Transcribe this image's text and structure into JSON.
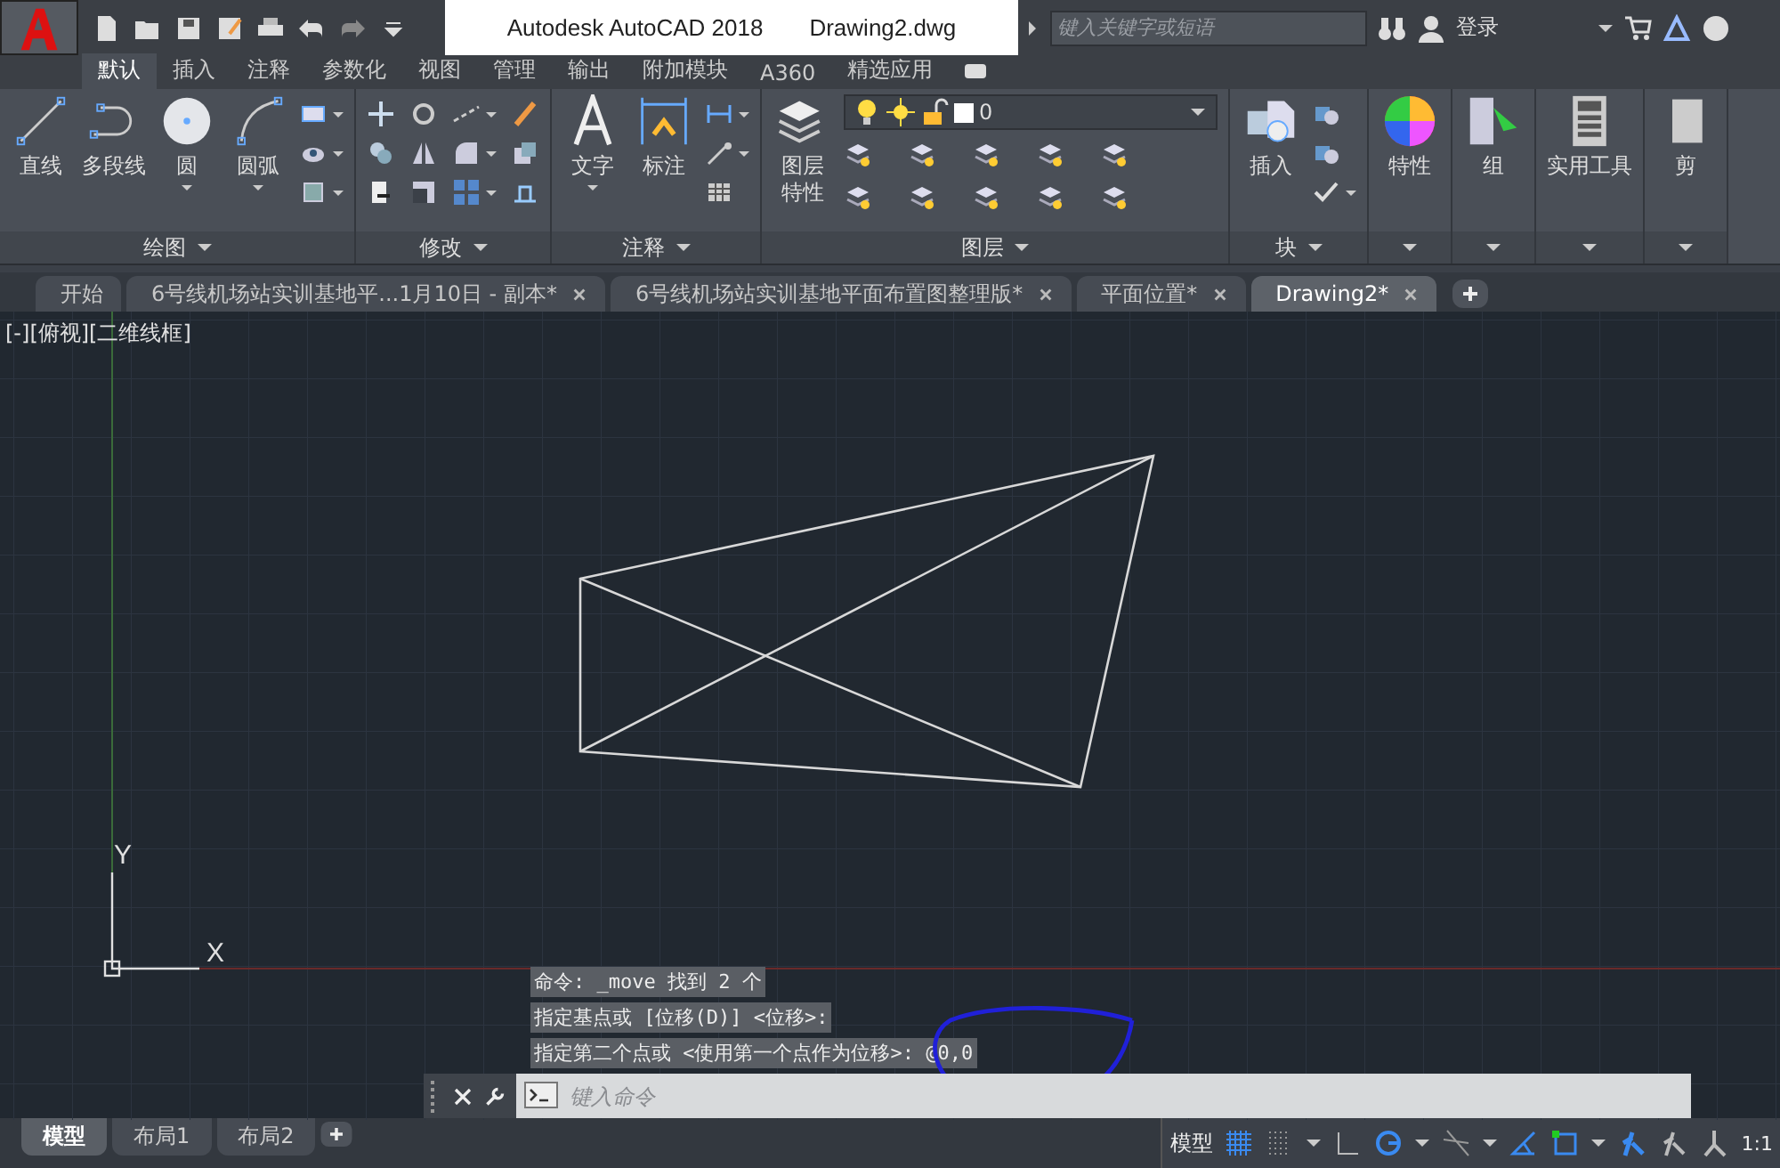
{
  "title": {
    "app": "Autodesk AutoCAD 2018",
    "document": "Drawing2.dwg"
  },
  "search": {
    "placeholder": "键入关键字或短语"
  },
  "user": {
    "label": "登录"
  },
  "ribbon_tabs": [
    {
      "label": "默认",
      "selected": true
    },
    {
      "label": "插入",
      "selected": false
    },
    {
      "label": "注释",
      "selected": false
    },
    {
      "label": "参数化",
      "selected": false
    },
    {
      "label": "视图",
      "selected": false
    },
    {
      "label": "管理",
      "selected": false
    },
    {
      "label": "输出",
      "selected": false
    },
    {
      "label": "附加模块",
      "selected": false
    },
    {
      "label": "A360",
      "selected": false
    },
    {
      "label": "精选应用",
      "selected": false
    }
  ],
  "panels": [
    {
      "title": "绘图",
      "tools": [
        {
          "label": "直线",
          "kind": "line",
          "menu": false
        },
        {
          "label": "多段线",
          "kind": "polyline",
          "menu": false
        },
        {
          "label": "圆",
          "kind": "circle",
          "menu": true
        },
        {
          "label": "圆弧",
          "kind": "arc",
          "menu": true
        }
      ],
      "small_tools": [
        {
          "kind": "rectangle",
          "menu": true
        },
        {
          "kind": "hatch",
          "menu": true
        },
        {
          "kind": "boundary",
          "menu": true
        }
      ]
    },
    {
      "title": "修改",
      "small_tools": [
        {
          "kind": "move",
          "menu": false
        },
        {
          "kind": "copy",
          "menu": false
        },
        {
          "kind": "stretch",
          "menu": false
        },
        {
          "kind": "rotate",
          "menu": false
        },
        {
          "kind": "mirror",
          "menu": false
        },
        {
          "kind": "scale",
          "menu": false
        },
        {
          "kind": "trim",
          "menu": true
        },
        {
          "kind": "fillet",
          "menu": true
        },
        {
          "kind": "array",
          "menu": true
        },
        {
          "kind": "brush",
          "menu": false
        },
        {
          "kind": "explode",
          "menu": false
        },
        {
          "kind": "offset",
          "menu": false
        }
      ]
    },
    {
      "title": "注释",
      "tools": [
        {
          "label": "文字",
          "kind": "text",
          "menu": true
        },
        {
          "label": "标注",
          "kind": "dimension",
          "menu": false
        }
      ],
      "small_tools": [
        {
          "kind": "linear",
          "menu": true
        },
        {
          "kind": "leader",
          "menu": true
        },
        {
          "kind": "table",
          "menu": false
        }
      ]
    },
    {
      "title": "图层",
      "tools": [
        {
          "label": "图层特性",
          "kind": "layers",
          "menu": false
        }
      ],
      "layer": {
        "value": "0"
      },
      "small_tools": [
        {
          "kind": "layer",
          "menu": false
        },
        {
          "kind": "layer",
          "menu": false
        },
        {
          "kind": "layer",
          "menu": false
        },
        {
          "kind": "layer",
          "menu": false
        },
        {
          "kind": "layer",
          "menu": false
        },
        {
          "kind": "layer",
          "menu": false
        },
        {
          "kind": "layer",
          "menu": false
        },
        {
          "kind": "layer",
          "menu": false
        },
        {
          "kind": "layer",
          "menu": false
        },
        {
          "kind": "layer",
          "menu": false
        }
      ]
    },
    {
      "title": "块",
      "tools": [
        {
          "label": "插入",
          "kind": "insert",
          "menu": false
        }
      ],
      "small_tools": [
        {
          "kind": "block",
          "menu": false
        },
        {
          "kind": "block",
          "menu": false
        },
        {
          "kind": "attribute",
          "menu": true
        }
      ]
    },
    {
      "tools": [
        {
          "label": "特性",
          "kind": "colorwheel",
          "menu": false
        }
      ]
    },
    {
      "tools": [
        {
          "label": "组",
          "kind": "group",
          "menu": false
        }
      ]
    },
    {
      "tools": [
        {
          "label": "实用工具",
          "kind": "calculator",
          "menu": false
        }
      ]
    },
    {
      "tools": [
        {
          "label": "剪",
          "kind": "clipboard",
          "menu": false
        }
      ]
    }
  ],
  "doc_tabs": [
    {
      "label": "开始",
      "selected": false,
      "closable": false
    },
    {
      "label": "6号线机场站实训基地平...1月10日 - 副本*",
      "selected": false,
      "closable": true
    },
    {
      "label": "6号线机场站实训基地平面布置图整理版*",
      "selected": false,
      "closable": true
    },
    {
      "label": "平面位置*",
      "selected": false,
      "closable": true
    },
    {
      "label": "Drawing2*",
      "selected": true,
      "closable": true
    }
  ],
  "viewport_label": "[-][俯视][二维线框]",
  "ucs": {
    "x": "X",
    "y": "Y"
  },
  "command_history": [
    "命令: _move 找到 2 个",
    "指定基点或 [位移(D)] <位移>:",
    "指定第二个点或 <使用第一个点作为位移>: @0,0"
  ],
  "command_line": {
    "placeholder": "键入命令"
  },
  "layout_tabs": [
    {
      "label": "模型",
      "selected": true
    },
    {
      "label": "布局1",
      "selected": false
    },
    {
      "label": "布局2",
      "selected": false
    }
  ],
  "status_bar": {
    "mode": "模型",
    "scale": "1:1"
  }
}
